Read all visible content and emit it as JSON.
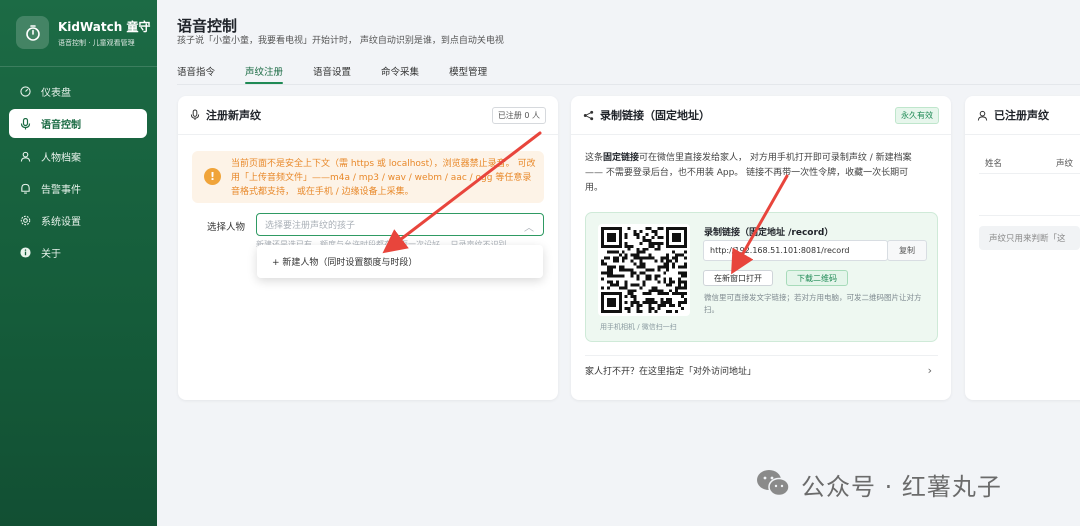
{
  "brand": {
    "name": "KidWatch 童守",
    "subtitle": "语音控制 · 儿童观看管理"
  },
  "sidebar": {
    "items": [
      {
        "label": "仪表盘",
        "icon": "dashboard-icon"
      },
      {
        "label": "语音控制",
        "icon": "microphone-icon",
        "active": true
      },
      {
        "label": "人物档案",
        "icon": "person-icon"
      },
      {
        "label": "告警事件",
        "icon": "bell-icon"
      },
      {
        "label": "系统设置",
        "icon": "gear-icon"
      },
      {
        "label": "关于",
        "icon": "info-icon"
      }
    ]
  },
  "header": {
    "title": "语音控制",
    "subtitle": "孩子说「小童小童，我要看电视」开始计时， 声纹自动识别是谁，到点自动关电视"
  },
  "tabs": [
    {
      "label": "语音指令"
    },
    {
      "label": "声纹注册",
      "active": true
    },
    {
      "label": "语音设置"
    },
    {
      "label": "命令采集"
    },
    {
      "label": "模型管理"
    }
  ],
  "register_card": {
    "title": "注册新声纹",
    "count_badge": "已注册 0 人",
    "warning": "当前页面不是安全上下文（需 https 或 localhost），浏览器禁止录音。 可改用「上传音频文件」——m4a / mp3 / wav / webm / aac / ogg 等任意录音格式都支持， 或在手机 / 边缘设备上采集。",
    "select_label": "选择人物",
    "select_placeholder": "选择要注册声纹的孩子",
    "select_hint": "新建还是选已有，额度与允许时段都在下面一次设好。 只录声纹不识别",
    "dropdown_option": "+  新建人物（同时设置额度与时段）"
  },
  "link_card": {
    "title": "录制链接（固定地址）",
    "badge": "永久有效",
    "desc_prefix": "这条",
    "desc_bold": "固定链接",
    "desc_rest": "可在微信里直接发给家人， 对方用手机打开即可录制声纹 / 新建档案—— 不需要登录后台，也不用装 App。 链接不再带一次性令牌，收藏一次长期可用。",
    "qr_caption": "用手机相机 / 微信扫一扫",
    "record_label": "录制链接（固定地址 /record）",
    "url": "http://192.168.51.101:8081/record",
    "copy_label": "复制",
    "open_label": "在新窗口打开",
    "download_label": "下载二维码",
    "note": "微信里可直接发文字链接；若对方用电脑，可发二维码图片让对方扫。",
    "access_text": "家人打不开？在这里指定「对外访问地址」"
  },
  "registered_card": {
    "title": "已注册声纹",
    "col_name": "姓名",
    "col_voiceprint": "声纹",
    "info": "声纹只用来判断「这"
  },
  "watermark": {
    "text": "公众号 · 红薯丸子"
  },
  "colors": {
    "brand_green": "#1c6b45",
    "accent": "#1f8a55",
    "warning": "#e8892b",
    "annotation": "#e8453c"
  }
}
